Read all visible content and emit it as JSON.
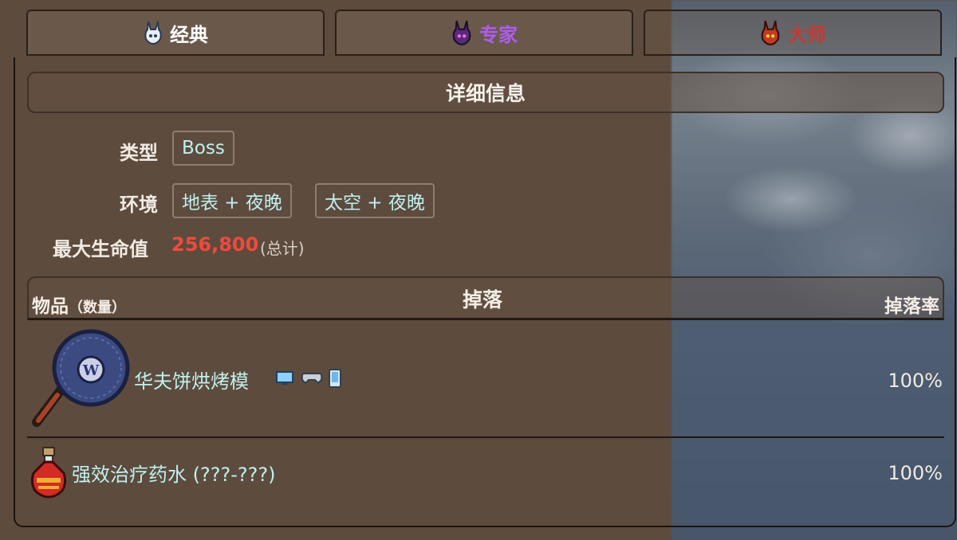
{
  "tabs": [
    {
      "label": "经典",
      "color": "#ffffff",
      "icon": "bunny-white-icon"
    },
    {
      "label": "专家",
      "color": "#b05cf0",
      "icon": "bunny-purple-icon"
    },
    {
      "label": "大师",
      "color": "#d8312a",
      "icon": "bunny-red-icon"
    }
  ],
  "details": {
    "header": "详细信息",
    "type_label": "类型",
    "type_value": "Boss",
    "env_label": "环境",
    "env_values": [
      "地表 + 夜晚",
      "太空 + 夜晚"
    ],
    "hp_label": "最大生命值",
    "hp_value": "256,800",
    "hp_note": "(总计)"
  },
  "drops": {
    "title": "掉落",
    "col_item": "物品",
    "col_qty": "（数量）",
    "col_rate": "掉落率",
    "items": [
      {
        "name": "华夫饼烘烤模",
        "rate": "100%",
        "icon": "waffle-iron-icon",
        "platform_icons": [
          "pc-icon",
          "console-icon",
          "mobile-icon"
        ]
      },
      {
        "name": "强效治疗药水 (???-???)",
        "rate": "100%",
        "icon": "potion-icon"
      }
    ]
  }
}
